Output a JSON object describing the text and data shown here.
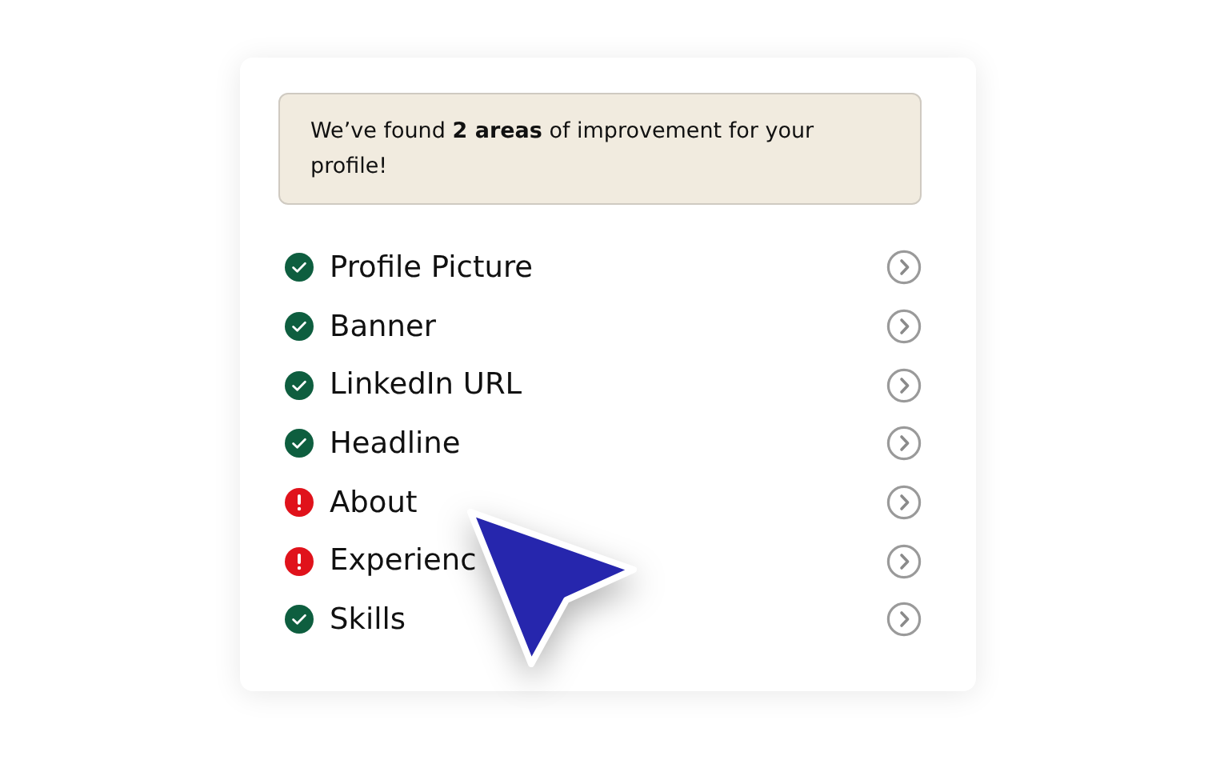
{
  "notice": "We’ve found **2 areas** of improvement for your profile!",
  "items": [
    {
      "label": "Profile Picture",
      "kind": "ok"
    },
    {
      "label": "Banner",
      "kind": "ok"
    },
    {
      "label": "LinkedIn URL",
      "kind": "ok"
    },
    {
      "label": "Headline",
      "kind": "ok"
    },
    {
      "label": "About",
      "kind": "issue"
    },
    {
      "label": "Experienc",
      "kind": "issue"
    },
    {
      "label": "Skills",
      "kind": "ok"
    }
  ]
}
